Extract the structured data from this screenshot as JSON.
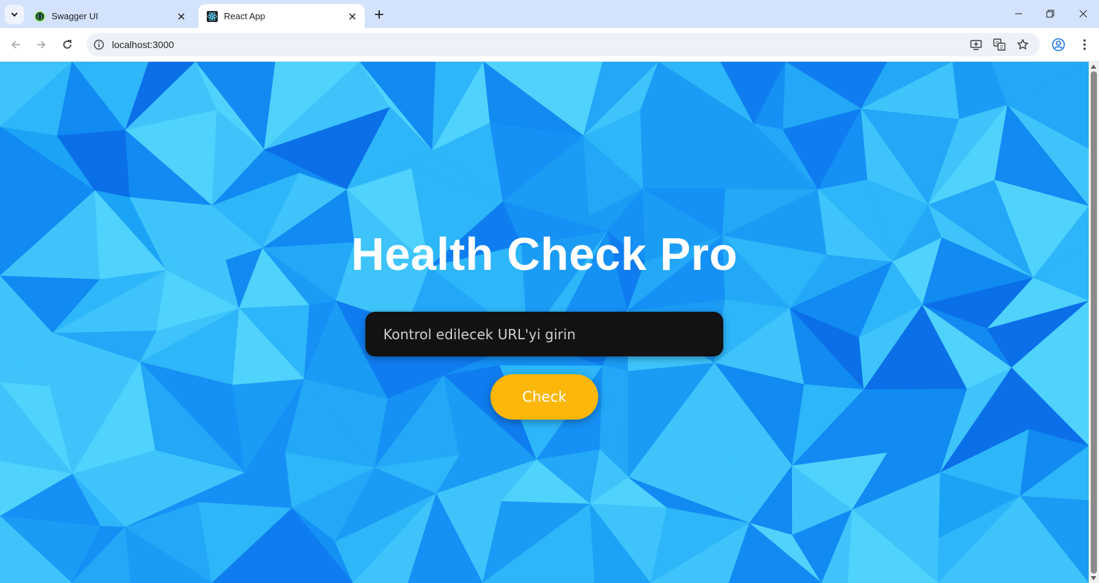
{
  "browser": {
    "tabs": [
      {
        "title": "Swagger UI",
        "active": false,
        "favicon": "swagger-icon"
      },
      {
        "title": "React App",
        "active": true,
        "favicon": "react-icon"
      }
    ],
    "address": "localhost:3000"
  },
  "app": {
    "title": "Health Check Pro",
    "url_placeholder": "Kontrol edilecek URL'yi girin",
    "check_label": "Check"
  },
  "colors": {
    "background": "#1a9cf5",
    "input_bg": "#121212",
    "button": "#fcb70a"
  }
}
